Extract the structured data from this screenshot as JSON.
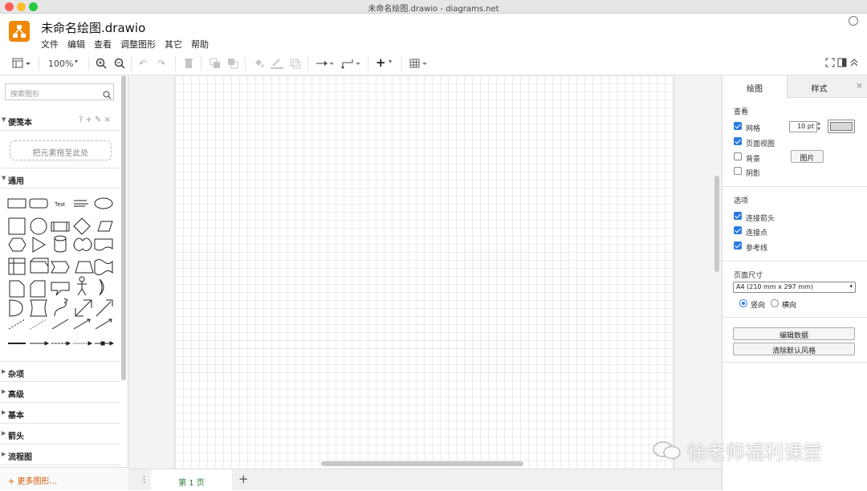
{
  "window": {
    "title": "未命名绘图.drawio - diagrams.net"
  },
  "app": {
    "doc_title": "未命名绘图.drawio"
  },
  "menu": [
    "文件",
    "编辑",
    "查看",
    "调整图形",
    "其它",
    "帮助"
  ],
  "toolbar": {
    "zoom": "100%"
  },
  "sidebar": {
    "search_placeholder": "搜索图形",
    "scratchpad_title": "便笺本",
    "scratchpad_icons": "? + ✎ ×",
    "drop_hint": "把元素拖至此处",
    "general_title": "通用",
    "shape_text": "Text",
    "sections": [
      "杂项",
      "高级",
      "基本",
      "箭头",
      "流程图"
    ],
    "more_shapes": "+ 更多图形..."
  },
  "pages": {
    "current": "第 1 页",
    "add_icon": "+"
  },
  "right_panel": {
    "tabs": [
      "绘图",
      "样式"
    ],
    "view_title": "查看",
    "grid_label": "网格",
    "grid_size": "10 pt",
    "page_view_label": "页面视图",
    "background_label": "背景",
    "image_button": "图片",
    "shadow_label": "阴影",
    "options_title": "选项",
    "connection_arrows": "连接箭头",
    "connection_points": "连接点",
    "guides": "参考线",
    "paper_size_title": "页面尺寸",
    "paper_size": "A4 (210 mm x 297 mm)",
    "portrait": "竖向",
    "landscape": "横向",
    "edit_data": "编辑数据",
    "clear_style": "清除默认风格"
  },
  "watermark": "徐老师福利课堂",
  "colors": {
    "accent": "#2a7ae2",
    "logo": "#f08705",
    "page_tab": "#2e7d32",
    "more": "#d35400"
  }
}
